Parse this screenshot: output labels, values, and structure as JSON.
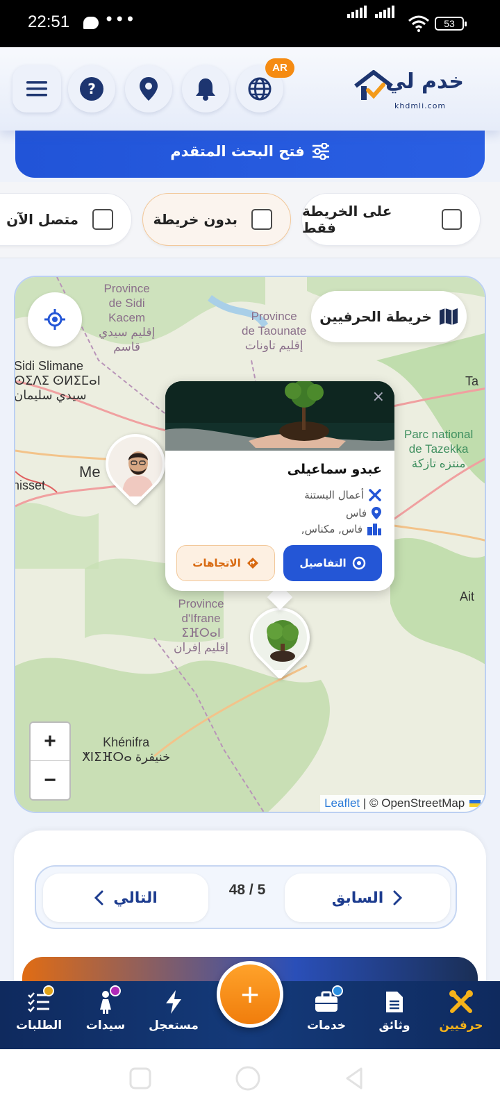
{
  "status_bar": {
    "time": "22:51",
    "dots": "•••",
    "battery": "53"
  },
  "header": {
    "lang_badge": "AR",
    "brand_text": "خدم لي",
    "domain": "khdmli.com"
  },
  "advanced_search": {
    "label": "فتح البحث المتقدم"
  },
  "filters": [
    {
      "label": "على الخريطة فقط",
      "checked": false
    },
    {
      "label": "بدون خريطة",
      "checked": false
    },
    {
      "label": "متصل الآن",
      "checked": false
    }
  ],
  "map": {
    "title": "خريطة الحرفيين",
    "labels": {
      "sidi_kacem": "Province\nde Sidi\nKacem\nإقليم سيدي\nقاسم",
      "taounate": "Province\nde Taounate\nإقليم تاونات",
      "sidi_slimane": "Sidi Slimane\nⵙⵉⴷⵉ ⵙⵍⵉⵎⴰⵏ\nسيدي سليمان",
      "tazekka": "Parc national\nde Tazekka\nمنتزه تازكة",
      "ifrane": "Province\nd'Ifrane\nⵉⴼⵔⴰⵏ\nإقليم إفران",
      "khenifra": "Khénifra\nⵅⵏⵉⴼⵔⴰ خنيفرة",
      "meknes": "Me",
      "khemisset": "nisset",
      "ta": "Ta",
      "ait": "Ait"
    },
    "zoom_in": "+",
    "zoom_out": "−",
    "attribution_leaflet": "Leaflet",
    "attribution_osm": " | © OpenStreetMap"
  },
  "popup": {
    "close": "×",
    "name": "عبدو سماعيلى",
    "service": "أعمال البستنة",
    "city": "فاس",
    "area": "فاس, مكناس,",
    "details_label": "التفاصيل",
    "directions_label": "الاتجاهات"
  },
  "pagination": {
    "prev_label": "السابق",
    "next_label": "التالي",
    "count": "48 / 5"
  },
  "bottom_nav": [
    {
      "label": "حرفيين",
      "icon": "tools-icon",
      "active": true
    },
    {
      "label": "وثائق",
      "icon": "document-icon"
    },
    {
      "label": "خدمات",
      "icon": "briefcase-icon"
    },
    {
      "label": "مستعجل",
      "icon": "bolt-icon"
    },
    {
      "label": "سيدات",
      "icon": "woman-icon"
    },
    {
      "label": "الطلبات",
      "icon": "checklist-icon"
    }
  ],
  "fab_label": "+",
  "colors": {
    "primary": "#2456d6",
    "accent": "#f58b12",
    "nav": "#0f2a5e",
    "active": "#f5b21a"
  }
}
